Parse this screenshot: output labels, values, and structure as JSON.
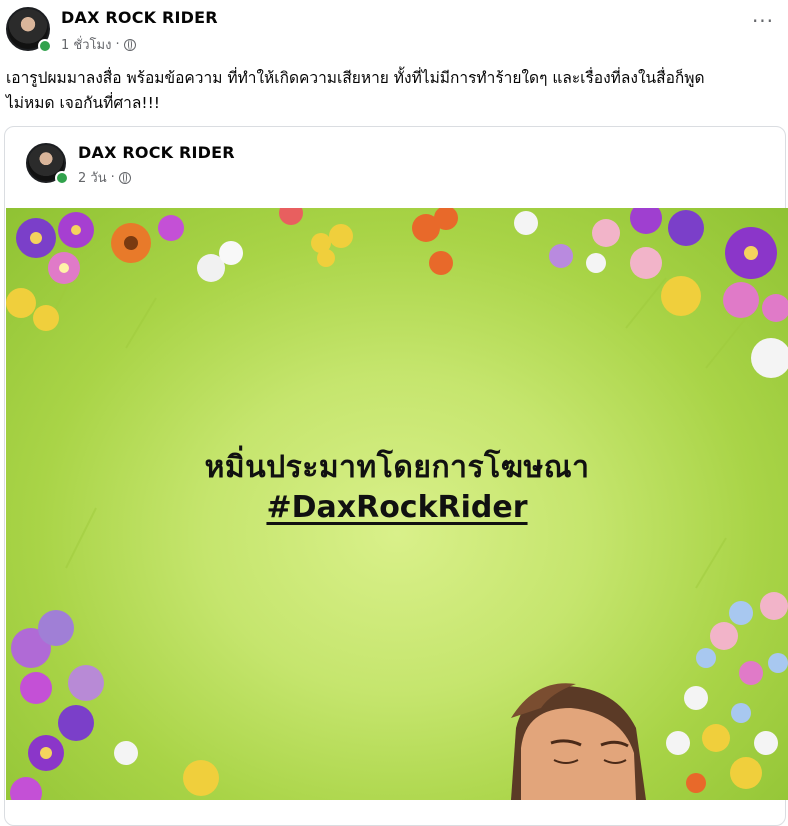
{
  "post": {
    "author": "DAX ROCK RIDER",
    "time": "1 ชั่วโมง",
    "separator": "·",
    "more_label": "···",
    "caption_line1": "เอารูปผมมาลงสื่อ พร้อมข้อความ ที่ทำให้เกิดความเสียหาย  ทั้งที่ไม่มีการทำร้ายใดๆ และเรื่องที่ลงในสื่อก็พูด",
    "caption_line2": "ไม่หมด เจอกันที่ศาล!!!"
  },
  "shared_post": {
    "author": "DAX ROCK RIDER",
    "time": "2 วัน",
    "separator": "·",
    "image_text_line1": "หมิ่นประมาทโดยการโฆษณา",
    "image_text_line2": "#DaxRockRider"
  },
  "colors": {
    "online": "#31a24c",
    "meta_text": "#65676b",
    "grass": "#b6dc55"
  },
  "icons": [
    "globe-icon",
    "more-options-icon",
    "avatar",
    "online-status-icon"
  ]
}
